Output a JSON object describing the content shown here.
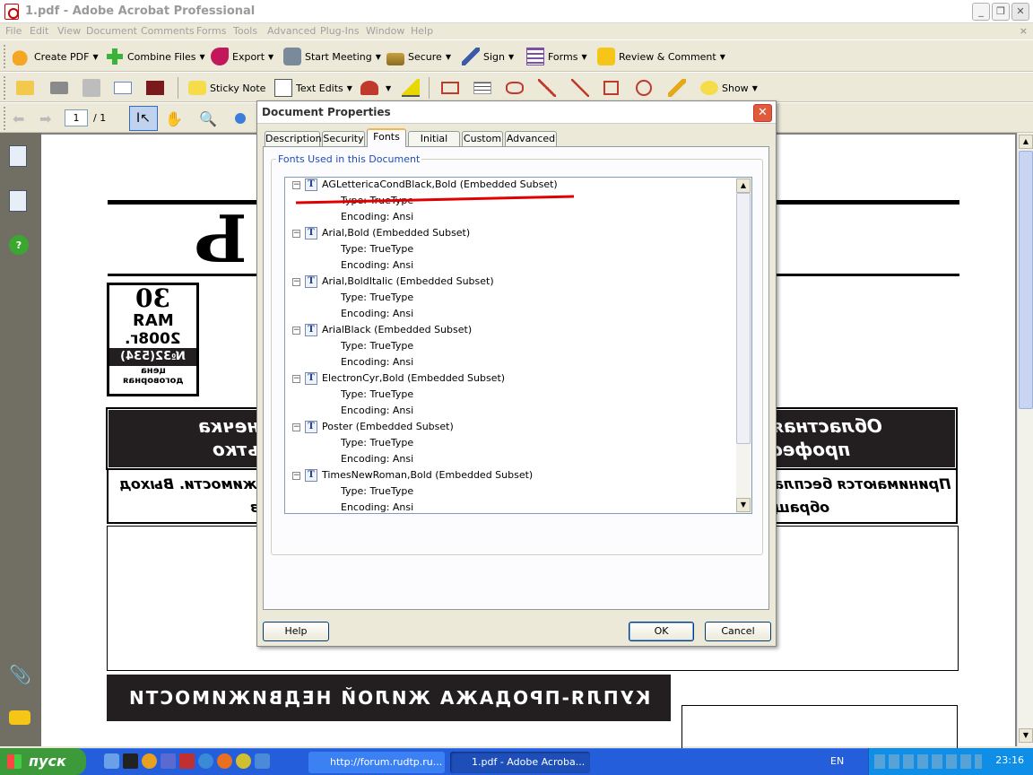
{
  "window": {
    "title": "1.pdf - Adobe Acrobat Professional"
  },
  "menu": [
    "File",
    "Edit",
    "View",
    "Document",
    "Comments",
    "Forms",
    "Tools",
    "Advanced",
    "Plug-Ins",
    "Window",
    "Help"
  ],
  "toolbar1": [
    {
      "label": "Create PDF",
      "icon": "create-pdf-icon"
    },
    {
      "label": "Combine Files",
      "icon": "combine-files-icon"
    },
    {
      "label": "Export",
      "icon": "export-icon"
    },
    {
      "label": "Start Meeting",
      "icon": "meeting-icon"
    },
    {
      "label": "Secure",
      "icon": "lock-icon"
    },
    {
      "label": "Sign",
      "icon": "pen-icon"
    },
    {
      "label": "Forms",
      "icon": "forms-icon"
    },
    {
      "label": "Review & Comment",
      "icon": "review-icon"
    }
  ],
  "toolbar2": {
    "sticky_note": "Sticky Note",
    "text_edits": "Text Edits",
    "show": "Show"
  },
  "nav": {
    "page_value": "1",
    "page_total": "/ 1"
  },
  "dialog": {
    "title": "Document Properties",
    "tabs": [
      "Description",
      "Security",
      "Fonts",
      "Initial View",
      "Custom",
      "Advanced"
    ],
    "active_tab": "Fonts",
    "group_label": "Fonts Used in this Document",
    "fonts": [
      {
        "name": "AGLettericaCondBlack,Bold (Embedded Subset)",
        "type": "Type: TrueType",
        "encoding": "Encoding: Ansi"
      },
      {
        "name": "Arial,Bold (Embedded Subset)",
        "type": "Type: TrueType",
        "encoding": "Encoding: Ansi"
      },
      {
        "name": "Arial,BoldItalic (Embedded Subset)",
        "type": "Type: TrueType",
        "encoding": "Encoding: Ansi"
      },
      {
        "name": "ArialBlack (Embedded Subset)",
        "type": "Type: TrueType",
        "encoding": "Encoding: Ansi"
      },
      {
        "name": "ElectronCyr,Bold (Embedded Subset)",
        "type": "Type: TrueType",
        "encoding": "Encoding: Ansi"
      },
      {
        "name": "Poster (Embedded Subset)",
        "type": "Type: TrueType",
        "encoding": "Encoding: Ansi"
      },
      {
        "name": "TimesNewRoman,Bold (Embedded Subset)",
        "type": "Type: TrueType",
        "encoding": "Encoding: Ansi"
      }
    ],
    "help": "Help",
    "ok": "OK",
    "cancel": "Cancel"
  },
  "newspaper": {
    "big_glyph": "Ь",
    "date_day": "30",
    "date_month": "МАЯ",
    "date_year": "2008г.",
    "issue": "№32(534)",
    "price1": "цена",
    "price2": "договорная",
    "banner_left1": "нечка",
    "banner_left2": "ьтко",
    "banner_right1": "Областная",
    "banner_right2": "профес",
    "line_left1": "жимости. Выход",
    "line_left2": "з",
    "line_right1": "Принимаются беспла",
    "line_right2": "обращ",
    "footer_banner": "КУПЛЯ-ПРОДАЖА   ЖИЛОЙ   НЕДВИЖИМОСТИ"
  },
  "taskbar": {
    "start": "пуск",
    "tasks": [
      "http://forum.rudtp.ru...",
      "1.pdf - Adobe Acroba..."
    ],
    "lang": "EN",
    "clock": "23:16"
  },
  "colors": {
    "accent_underline": "#e00000",
    "taskbar": "#245edb",
    "tab_highlight": "#f7b54b"
  }
}
